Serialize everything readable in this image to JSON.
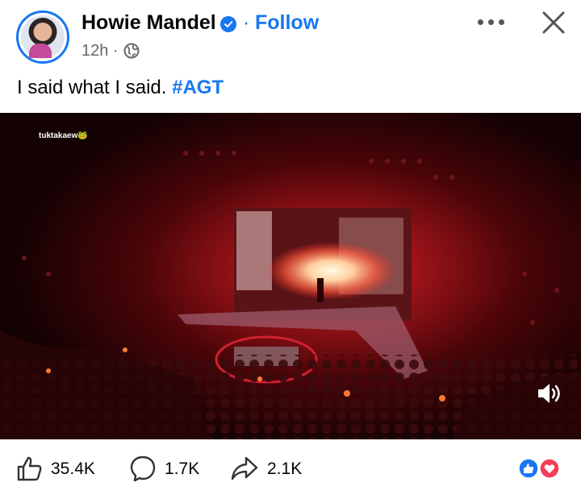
{
  "post": {
    "author": "Howie Mandel",
    "separator": "·",
    "follow_label": "Follow",
    "time": "12h ·",
    "caption_text": "I said what I said. ",
    "hashtag": "#AGT"
  },
  "video": {
    "watermark": "tuktakaew🐸"
  },
  "actions": {
    "likes": "35.4K",
    "comments": "1.7K",
    "shares": "2.1K"
  },
  "colors": {
    "accent": "#1877f2",
    "love": "#f33e58"
  },
  "icons": [
    "verified-badge-icon",
    "globe-icon",
    "more-options-icon",
    "close-icon",
    "volume-icon",
    "like-icon",
    "comment-icon",
    "share-icon",
    "like-reaction-icon",
    "love-reaction-icon"
  ]
}
